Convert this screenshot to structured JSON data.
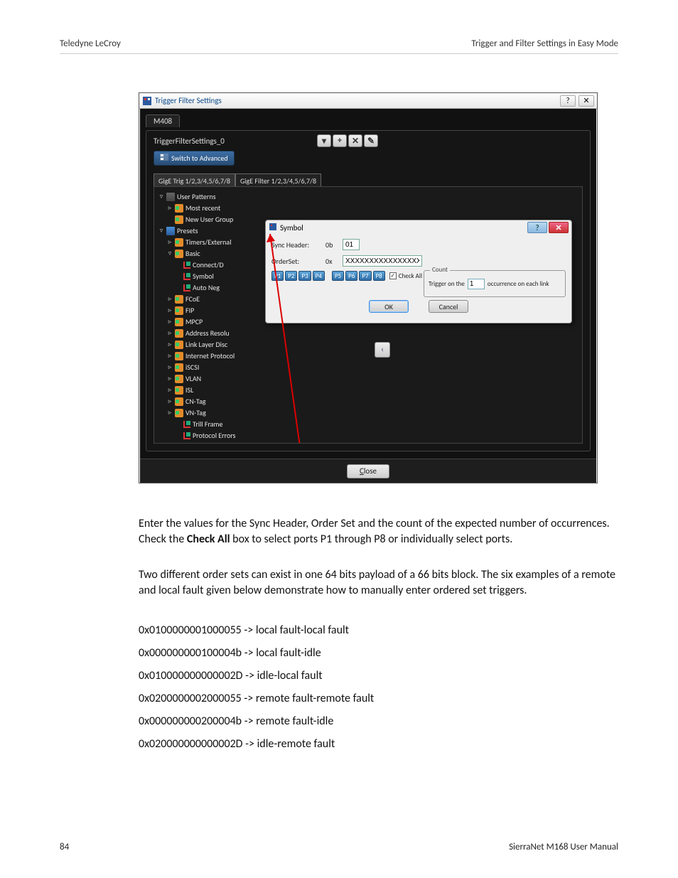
{
  "header": {
    "left": "Teledyne LeCroy",
    "right": "Trigger and Filter Settings in Easy Mode"
  },
  "window": {
    "title": "Trigger Filter Settings",
    "help_glyph": "?",
    "close_glyph": "✕",
    "device_tab": "M408",
    "setting_name": "TriggerFilterSettings_0",
    "tool_glyphs": {
      "drop": "▾",
      "add": "+",
      "del": "✕",
      "edit": "✎"
    },
    "switch_label": "Switch to Advanced",
    "subtabs": {
      "trig": "GigE Trig 1/2,3/4,5/6,7/8",
      "filter": "GigE Filter 1/2,3/4,5/6,7/8"
    },
    "close_btn": "Close"
  },
  "tree": {
    "user_patterns": "User Patterns",
    "most_recent": "Most recent",
    "new_user_group": "New User Group",
    "presets": "Presets",
    "timers": "Timers/External",
    "basic": "Basic",
    "connect": "Connect/D",
    "symbol": "Symbol",
    "autoneg": "Auto Neg",
    "fcoe": "FCoE",
    "fip": "FIP",
    "mpcp": "MPCP",
    "addr": "Address Resolu",
    "lld": "Link Layer Disc",
    "ip": "Internet Protocol",
    "iscsi": "iSCSI",
    "vlan": "VLAN",
    "isl": "ISL",
    "cntag": "CN-Tag",
    "vntag": "VN-Tag",
    "trill": "Trill Frame",
    "perr": "Protocol Errors"
  },
  "popup": {
    "title": "Symbol",
    "help": "?",
    "close": "✕",
    "sync_label": "Sync Header:",
    "sync_prefix": "0b",
    "sync_value": "01",
    "order_label": "OrderSet:",
    "order_prefix": "0x",
    "order_value": "XXXXXXXXXXXXXXXX",
    "ports": [
      "P1",
      "P2",
      "P3",
      "P4",
      "P5",
      "P6",
      "P7",
      "P8"
    ],
    "check_all": "Check All",
    "check_mark": "✓",
    "count_legend": "Count",
    "count_pre": "Trigger on the",
    "count_value": "1",
    "count_post": "occurrence on each link",
    "ok": "OK",
    "cancel": "Cancel"
  },
  "collapse_glyph": "‹",
  "body": {
    "p1a": "Enter the values for the Sync Header, Order Set and the count of the expected number of occurrences. Check the ",
    "p1b": "Check All",
    "p1c": " box to select ports P1 through P8 or individually select ports.",
    "p2": "Two different order sets can exist in one 64 bits payload of a 66 bits block. The six examples of a remote and local fault given below demonstrate how to manually enter ordered set triggers.",
    "l1": "0x0100000001000055 -> local fault-local fault",
    "l2": "0x000000000100004b -> local fault-idle",
    "l3": "0x010000000000002D -> idle-local fault",
    "l4": "0x0200000002000055 -> remote fault-remote fault",
    "l5": "0x000000000200004b -> remote fault-idle",
    "l6": "0x020000000000002D -> idle-remote fault"
  },
  "footer": {
    "page": "84",
    "doc": "SierraNet M168 User Manual"
  }
}
